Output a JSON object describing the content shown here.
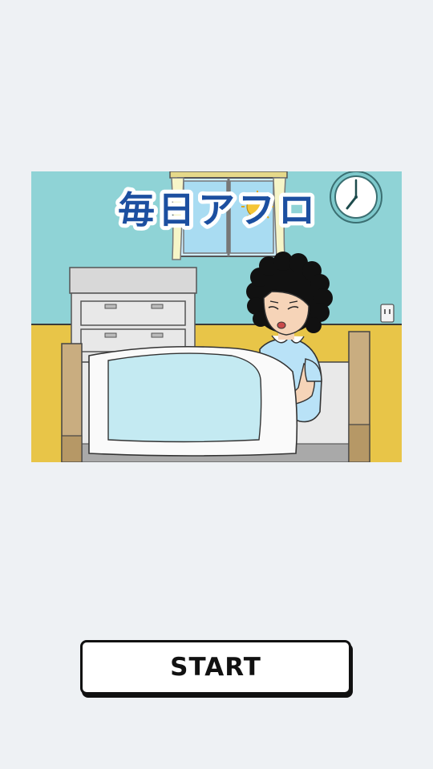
{
  "game": {
    "title": "毎日アフロ",
    "start_label": "START"
  },
  "colors": {
    "background": "#eef1f4",
    "wall": "#8fd3d6",
    "wainscot": "#e8c548",
    "title_fill": "#1c4fa0",
    "sheet": "#c4eaf2"
  }
}
